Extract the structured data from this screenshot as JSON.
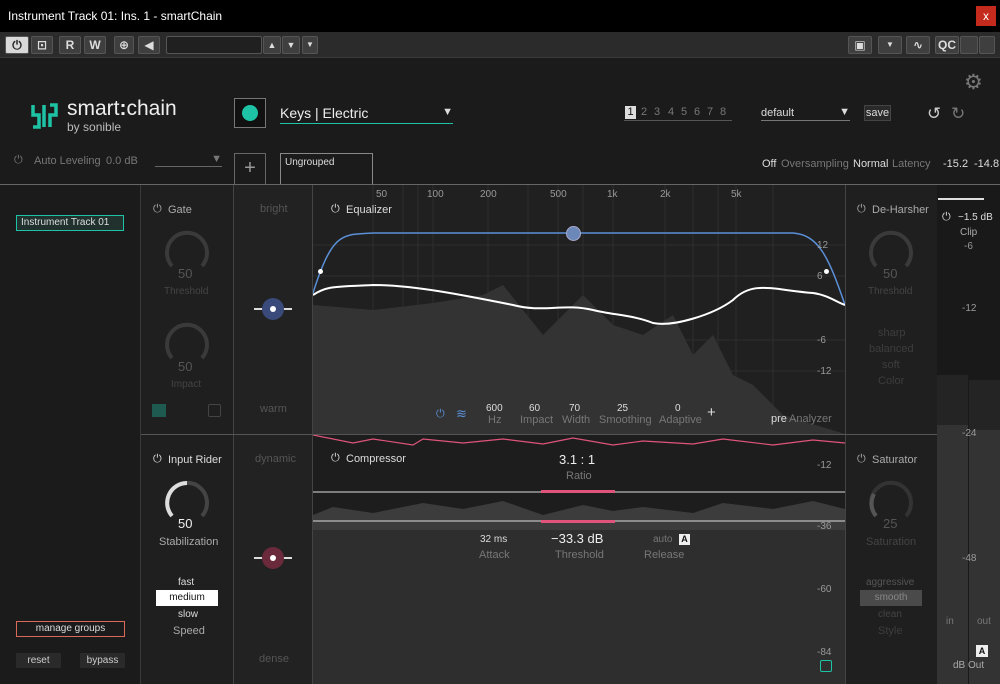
{
  "window": {
    "title": "Instrument Track 01: Ins. 1 - smartChain",
    "close_glyph": "x"
  },
  "toolbar": {
    "power": "⏻",
    "box": "⊡",
    "read": "R",
    "write": "W",
    "b": "⊕",
    "left": "◀",
    "up": "▲",
    "down": "▼",
    "dd": "▼",
    "cam": "▣",
    "dd2": "▼",
    "wave": "∿",
    "qc": "QC"
  },
  "header": {
    "brand_prefix": "smart",
    "brand_colon": ":",
    "brand_suffix": "chain",
    "brand_by": "by",
    "brand_maker": "sonible",
    "profile_name": "Keys | Electric",
    "profile_arrow": "▼",
    "slots": [
      "1",
      "2",
      "3",
      "4",
      "5",
      "6",
      "7",
      "8"
    ],
    "active_slot": "1",
    "preset": "default",
    "preset_arrow": "▼",
    "save": "save",
    "undo": "↺",
    "redo": "↻",
    "gear": "⚙"
  },
  "row2": {
    "auto_leveling": "Auto Leveling",
    "auto_leveling_value": "0.0 dB",
    "dd_arrow": "▼",
    "plus": "+",
    "group_tab": "Ungrouped",
    "os_off": "Off",
    "os_label": "Oversampling",
    "lat_mode": "Normal",
    "lat_label": "Latency",
    "meter_l": "-15.2",
    "meter_r": "-14.8"
  },
  "sidebar": {
    "track": "Instrument Track 01",
    "manage": "manage groups",
    "reset": "reset",
    "bypass": "bypass"
  },
  "gate": {
    "title": "Gate",
    "threshold_val": "50",
    "threshold_label": "Threshold",
    "impact_val": "50",
    "impact_label": "Impact"
  },
  "tone": {
    "top": "bright",
    "bottom": "warm"
  },
  "dyn": {
    "top": "dynamic",
    "bottom": "dense"
  },
  "eq": {
    "title": "Equalizer",
    "freq_ticks": [
      "50",
      "100",
      "200",
      "500",
      "1k",
      "2k",
      "5k"
    ],
    "db_ticks": [
      "12",
      "6",
      "-6",
      "-12"
    ],
    "params": [
      {
        "v": "600",
        "l": "Hz"
      },
      {
        "v": "60",
        "l": "Impact"
      },
      {
        "v": "70",
        "l": "Width"
      },
      {
        "v": "25",
        "l": "Smoothing"
      },
      {
        "v": "0",
        "l": "Adaptive"
      }
    ],
    "add": "+",
    "pre": "pre",
    "analyzer": "Analyzer"
  },
  "deharsher": {
    "title": "De-Harsher",
    "val": "50",
    "label": "Threshold",
    "modes": [
      "sharp",
      "balanced",
      "soft"
    ],
    "mode_label": "Color"
  },
  "rider": {
    "title": "Input Rider",
    "val": "50",
    "label": "Stabilization",
    "speeds": [
      "fast",
      "medium",
      "slow"
    ],
    "active_speed": "medium",
    "speed_label": "Speed"
  },
  "comp": {
    "title": "Compressor",
    "ratio_val": "3.1 : 1",
    "ratio_label": "Ratio",
    "attack_val": "32",
    "attack_unit": "ms",
    "attack_label": "Attack",
    "thr_val": "−33.3 dB",
    "thr_label": "Threshold",
    "rel_val": "auto",
    "rel_badge": "A",
    "rel_label": "Release",
    "db_ticks": [
      "-12",
      "-36",
      "-60",
      "-84"
    ]
  },
  "saturator": {
    "title": "Saturator",
    "val": "25",
    "label": "Saturation",
    "styles": [
      "aggressive",
      "smooth",
      "clean"
    ],
    "active_style": "smooth",
    "style_label": "Style"
  },
  "output": {
    "gain": "−1.5 dB",
    "clip": "Clip",
    "ticks": [
      "-6",
      "-12",
      "-24",
      "-48"
    ],
    "in": "in",
    "out": "out",
    "badge": "A",
    "label": "dB Out"
  },
  "colors": {
    "accent": "#1ec3a6",
    "eq_blue": "#5b8fd6",
    "comp_pink": "#e0547c"
  }
}
